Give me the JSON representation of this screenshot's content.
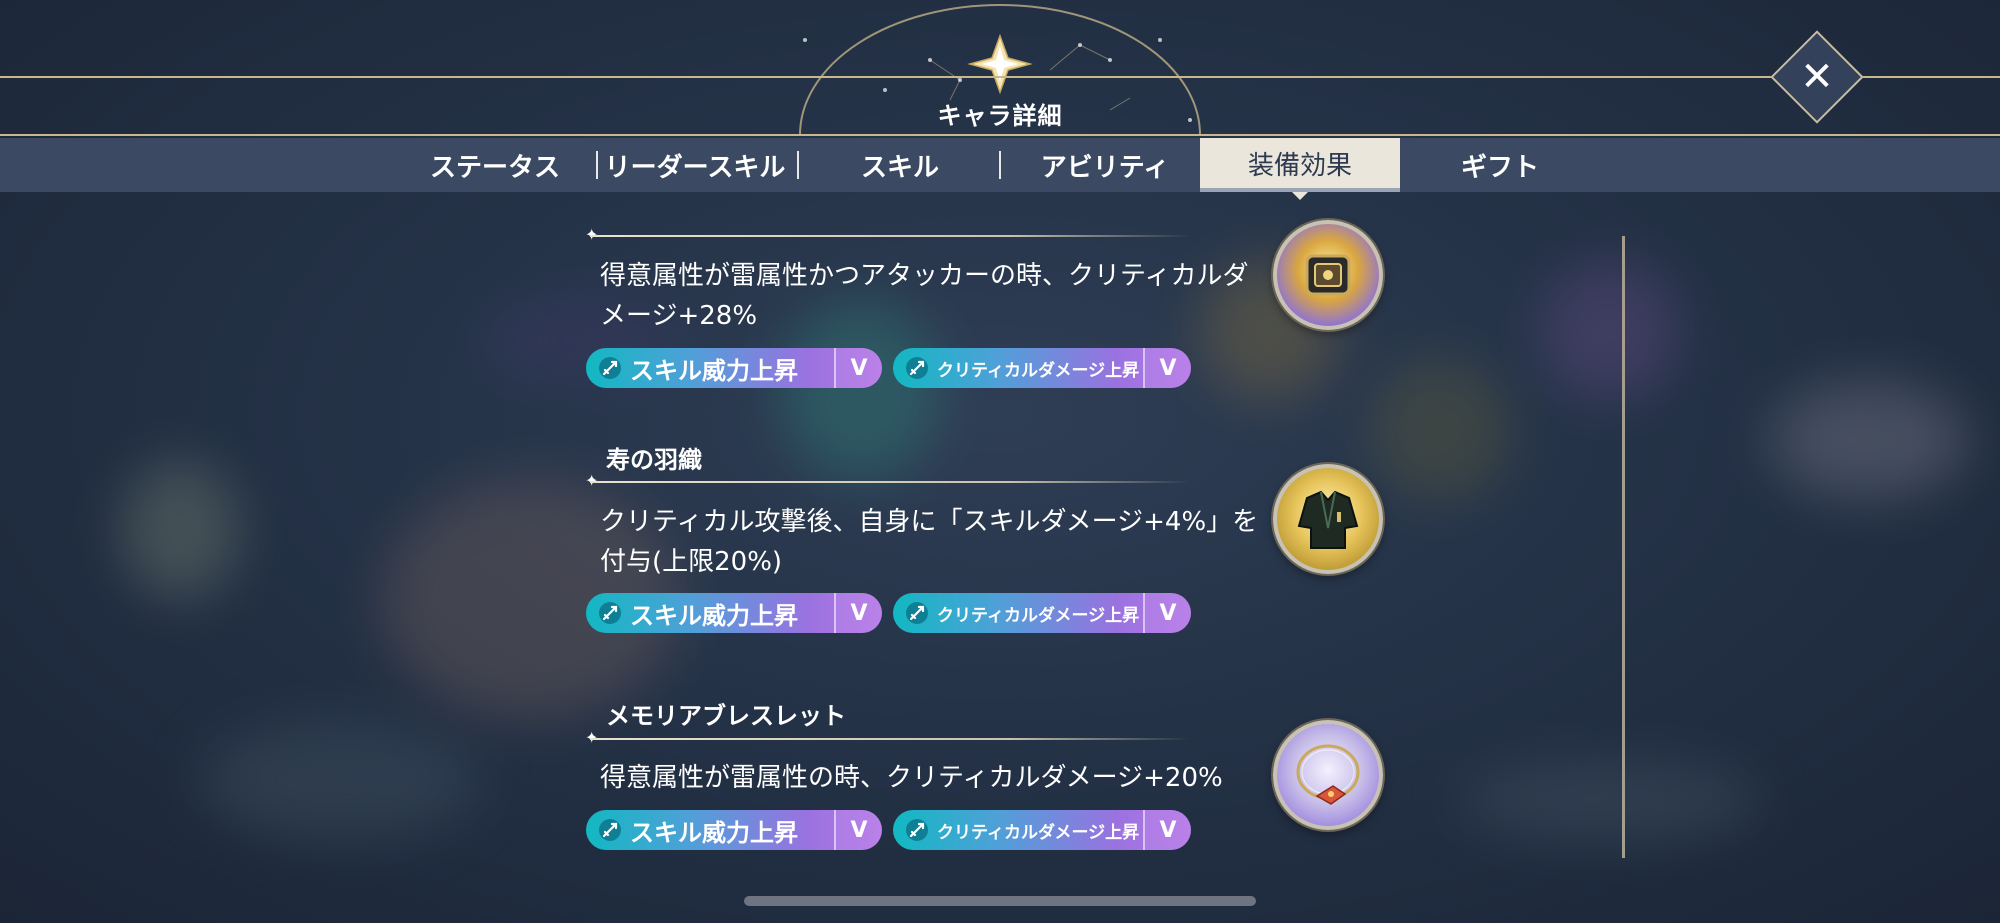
{
  "header": {
    "title": "キャラ詳細",
    "close_icon": "close-icon"
  },
  "tabs": [
    {
      "label": "ステータス",
      "active": false
    },
    {
      "label": "リーダースキル",
      "active": false
    },
    {
      "label": "スキル",
      "active": false
    },
    {
      "label": "アビリティ",
      "active": false
    },
    {
      "label": "装備効果",
      "active": true
    },
    {
      "label": "ギフト",
      "active": false
    }
  ],
  "equipment": [
    {
      "name": "",
      "description": "得意属性が雷属性かつアタッカーの時、クリティカルダメージ+28%",
      "icon": "golden-gem-icon",
      "tags": [
        {
          "label": "スキル威力上昇",
          "grade": "V"
        },
        {
          "label": "クリティカルダメージ上昇",
          "grade": "V"
        }
      ]
    },
    {
      "name": "寿の羽織",
      "description": "クリティカル攻撃後、自身に「スキルダメージ+4%」を付与(上限20%)",
      "icon": "haori-coat-icon",
      "tags": [
        {
          "label": "スキル威力上昇",
          "grade": "V"
        },
        {
          "label": "クリティカルダメージ上昇",
          "grade": "V"
        }
      ]
    },
    {
      "name": "メモリアブレスレット",
      "description": "得意属性が雷属性の時、クリティカルダメージ+20%",
      "icon": "bracelet-icon",
      "tags": [
        {
          "label": "スキル威力上昇",
          "grade": "V"
        },
        {
          "label": "クリティカルダメージ上昇",
          "grade": "V"
        }
      ]
    }
  ],
  "colors": {
    "accent": "#c9b88c",
    "tab_active": "#eae6dc",
    "pill_start": "#12b8c2",
    "pill_end": "#b77be6"
  }
}
